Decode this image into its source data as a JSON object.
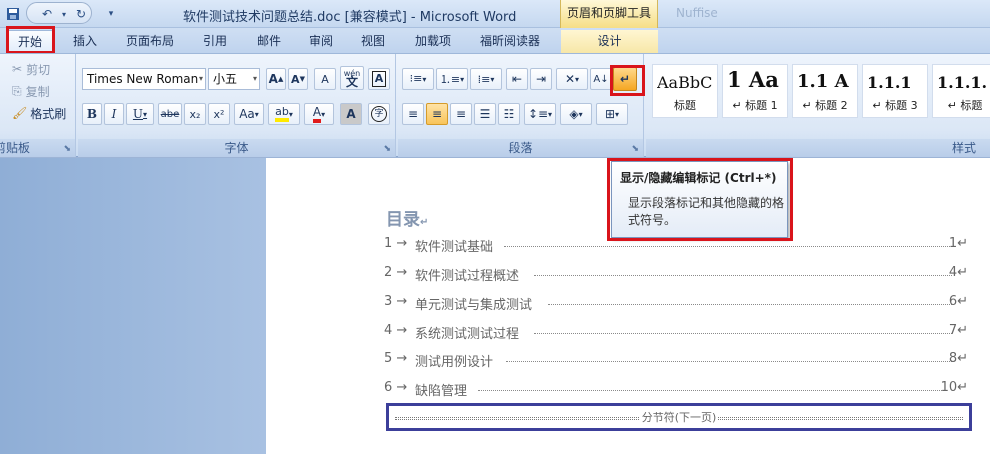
{
  "titlebar": {
    "title": "软件测试技术问题总结.doc [兼容模式] - Microsoft Word",
    "context_group": "页眉和页脚工具",
    "faded_text": "Nuffise",
    "qat": [
      "save-icon",
      "undo-icon",
      "redo-icon",
      "customize-icon"
    ]
  },
  "tabs": [
    {
      "label": "开始",
      "active": true
    },
    {
      "label": "插入"
    },
    {
      "label": "页面布局"
    },
    {
      "label": "引用"
    },
    {
      "label": "邮件"
    },
    {
      "label": "审阅"
    },
    {
      "label": "视图"
    },
    {
      "label": "加载项"
    },
    {
      "label": "福昕阅读器"
    },
    {
      "label": "设计",
      "contextual": true
    }
  ],
  "ribbon": {
    "clipboard": {
      "cut": "剪切",
      "copy": "复制",
      "format_painter": "格式刷",
      "label": "剪贴板"
    },
    "font": {
      "font_name": "Times New Roman",
      "font_size": "小五",
      "grow": "A",
      "shrink": "A",
      "label": "字体",
      "bold": "B",
      "italic": "I",
      "underline": "U",
      "strike": "abe",
      "subscript": "x₂",
      "superscript": "x²",
      "change_case": "Aa",
      "highlight": "ab",
      "font_color": "A",
      "char_shading": "A",
      "wen": "wén",
      "wen_char": "文",
      "enclose": "字"
    },
    "paragraph": {
      "label": "段落",
      "show_hide": "↵"
    },
    "styles": {
      "label": "样式",
      "items": [
        {
          "sample": "AaBbC",
          "name": "标题"
        },
        {
          "sample": "1 Aa",
          "name": "↵ 标题 1"
        },
        {
          "sample": "1.1 A",
          "name": "↵ 标题 2"
        },
        {
          "sample": "1.1.1",
          "name": "↵ 标题 3"
        },
        {
          "sample": "1.1.1.",
          "name": "↵ 标题"
        }
      ]
    }
  },
  "tooltip": {
    "title": "显示/隐藏编辑标记 (Ctrl+*)",
    "body": "显示段落标记和其他隐藏的格式符号。"
  },
  "document": {
    "toc_title": "目录",
    "toc": [
      {
        "num": "1 →",
        "text": "软件测试基础",
        "page": "1↵"
      },
      {
        "num": "2 →",
        "text": "软件测试过程概述",
        "page": "4↵"
      },
      {
        "num": "3 →",
        "text": "单元测试与集成测试",
        "page": "6↵"
      },
      {
        "num": "4 →",
        "text": "系统测试测试过程",
        "page": "7↵"
      },
      {
        "num": "5 →",
        "text": "测试用例设计",
        "page": "8↵"
      },
      {
        "num": "6 →",
        "text": "缺陷管理",
        "page": "10↵"
      }
    ],
    "section_break": "分节符(下一页)"
  },
  "colors": {
    "highlight_red": "#d9141b",
    "section_box": "#3c3f9a"
  }
}
